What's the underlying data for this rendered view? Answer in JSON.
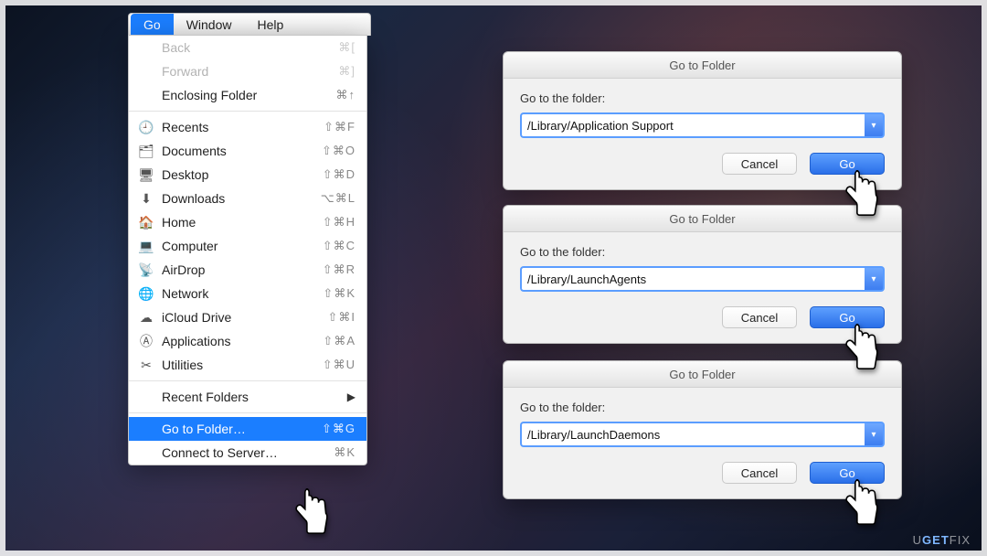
{
  "menubar": {
    "items": [
      "Go",
      "Window",
      "Help"
    ],
    "active_index": 0
  },
  "menu": {
    "groups": [
      [
        {
          "label": "Back",
          "shortcut": "⌘[",
          "disabled": true
        },
        {
          "label": "Forward",
          "shortcut": "⌘]",
          "disabled": true
        },
        {
          "label": "Enclosing Folder",
          "shortcut": "⌘↑"
        }
      ],
      [
        {
          "icon": "clock-icon",
          "label": "Recents",
          "shortcut": "⇧⌘F"
        },
        {
          "icon": "documents-icon",
          "label": "Documents",
          "shortcut": "⇧⌘O"
        },
        {
          "icon": "desktop-icon",
          "label": "Desktop",
          "shortcut": "⇧⌘D"
        },
        {
          "icon": "downloads-icon",
          "label": "Downloads",
          "shortcut": "⌥⌘L"
        },
        {
          "icon": "home-icon",
          "label": "Home",
          "shortcut": "⇧⌘H"
        },
        {
          "icon": "computer-icon",
          "label": "Computer",
          "shortcut": "⇧⌘C"
        },
        {
          "icon": "airdrop-icon",
          "label": "AirDrop",
          "shortcut": "⇧⌘R"
        },
        {
          "icon": "network-icon",
          "label": "Network",
          "shortcut": "⇧⌘K"
        },
        {
          "icon": "icloud-icon",
          "label": "iCloud Drive",
          "shortcut": "⇧⌘I"
        },
        {
          "icon": "applications-icon",
          "label": "Applications",
          "shortcut": "⇧⌘A"
        },
        {
          "icon": "utilities-icon",
          "label": "Utilities",
          "shortcut": "⇧⌘U"
        }
      ],
      [
        {
          "label": "Recent Folders",
          "submenu": true
        }
      ],
      [
        {
          "label": "Go to Folder…",
          "shortcut": "⇧⌘G",
          "highlight": true
        },
        {
          "label": "Connect to Server…",
          "shortcut": "⌘K"
        }
      ]
    ]
  },
  "dialogs": [
    {
      "title": "Go to Folder",
      "prompt": "Go to the folder:",
      "value": "/Library/Application Support",
      "cancel": "Cancel",
      "go": "Go"
    },
    {
      "title": "Go to Folder",
      "prompt": "Go to the folder:",
      "value": "/Library/LaunchAgents",
      "cancel": "Cancel",
      "go": "Go"
    },
    {
      "title": "Go to Folder",
      "prompt": "Go to the folder:",
      "value": "/Library/LaunchDaemons",
      "cancel": "Cancel",
      "go": "Go"
    }
  ],
  "watermark": {
    "a": "U",
    "b": "GET",
    "c": "FIX"
  },
  "icons": {
    "clock-icon": "🕘",
    "documents-icon": "🗂",
    "desktop-icon": "🖥",
    "downloads-icon": "⬇︎",
    "home-icon": "🏠",
    "computer-icon": "💻",
    "airdrop-icon": "📡",
    "network-icon": "🌐",
    "icloud-icon": "☁︎",
    "applications-icon": "Ⓐ",
    "utilities-icon": "✂︎"
  }
}
